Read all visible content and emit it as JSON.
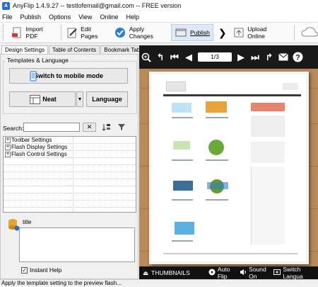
{
  "window": {
    "title": "AnyFlip 1.4.9.27 -- testlofemail@gmail.com -- FREE version"
  },
  "menu": [
    "File",
    "Publish",
    "Options",
    "View",
    "Online",
    "Help"
  ],
  "toolbar": {
    "import_pdf": "Import PDF",
    "edit_pages": "Edit Pages",
    "apply_changes": "Apply Changes",
    "publish": "Publish",
    "upload_online": "Upload Online"
  },
  "tabs": [
    "Design Settings",
    "Table of Contents",
    "Bookmark Tabs"
  ],
  "templates": {
    "header": "Templates & Language",
    "mobile_button": "Switch to mobile mode",
    "template_name": "Neat",
    "language_button": "Language"
  },
  "search": {
    "label": "Search:",
    "value": ""
  },
  "tree_items": [
    "Toolbar Settings",
    "Flash Display Settings",
    "Flash Control Settings"
  ],
  "description": {
    "title": "title",
    "text": ""
  },
  "instant_help": {
    "label": "Instant Help",
    "checked": true
  },
  "status_text": "Apply the template setting to the preview flash...",
  "preview": {
    "page_indicator": "1/3",
    "thumbnails_label": "THUMBNAILS",
    "auto_flip_label": "Auto Flip",
    "sound_label": "Sound On",
    "switch_language_label": "Switch Langua"
  }
}
